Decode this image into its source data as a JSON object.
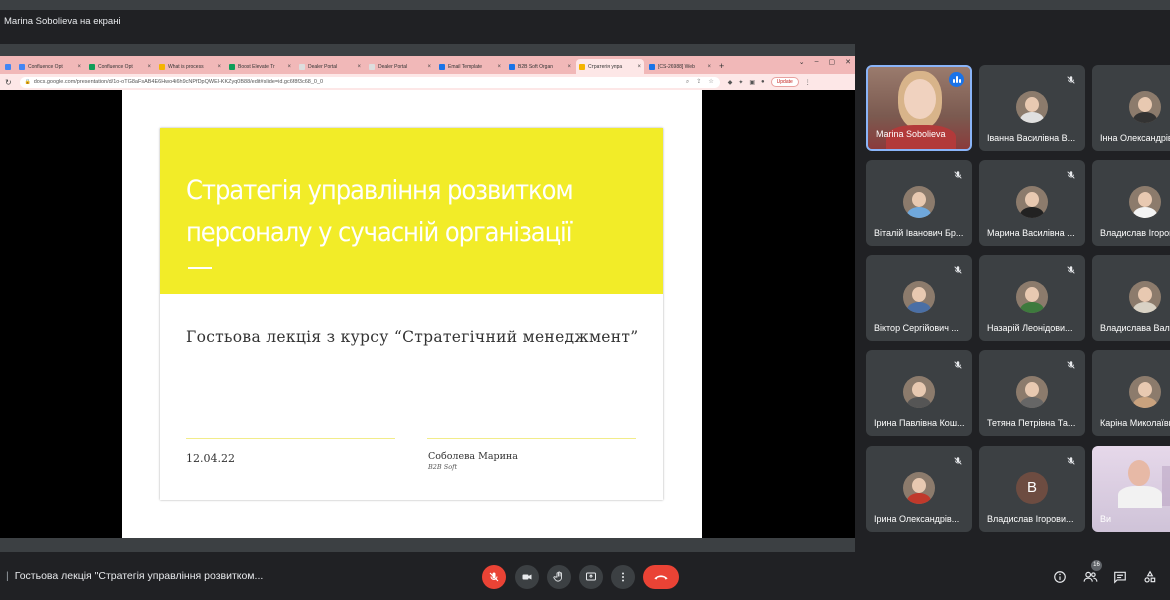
{
  "presenter_bar": {
    "text": "Marina Sobolieva на екрані"
  },
  "browser": {
    "tabs": [
      {
        "label": "",
        "color": "#4285f4"
      },
      {
        "label": "Confluence Opt",
        "color": "#4285f4"
      },
      {
        "label": "Confluence Opt",
        "color": "#0f9d58"
      },
      {
        "label": "What is process",
        "color": "#f4b400"
      },
      {
        "label": "Boost Elevate Tr",
        "color": "#0f9d58"
      },
      {
        "label": "Dealer Portal",
        "color": "#dddddd"
      },
      {
        "label": "Dealer Portal",
        "color": "#dddddd"
      },
      {
        "label": "Email Template",
        "color": "#1a73e8"
      },
      {
        "label": "B2B Soft Organ",
        "color": "#1a73e8"
      },
      {
        "label": "Стратегія упра",
        "color": "#f4b400",
        "active": true
      },
      {
        "label": "[CS-26988] Web",
        "color": "#1a73e8"
      }
    ],
    "new_tab": "+",
    "url": "docs.google.com/presentation/d/1o-oTG8aFsAB4E6Hwo4i6h9cNPfDpQWEl-KKZyq0B88/edit#slide=id.gc6f8f3c68_0_0",
    "update_label": "Update"
  },
  "slide": {
    "title": "Стратегія управління розвитком персоналу у сучасній організації",
    "subtitle": "Гостьова лекція з курсу “Стратегічний менеджмент”",
    "date": "12.04.22",
    "author": "Соболева Марина",
    "company": "B2B Soft"
  },
  "participants": [
    {
      "name": "Marina Sobolieva",
      "speaking": true
    },
    {
      "name": "Іванна Василівна В...",
      "shirt": "#e0e0e0"
    },
    {
      "name": "Інна Олександрівна",
      "shirt": "#333333"
    },
    {
      "name": "Віталій Іванович Бр...",
      "shirt": "#6fa8dc"
    },
    {
      "name": "Марина Василівна ...",
      "shirt": "#222222"
    },
    {
      "name": "Владислав Ігорович",
      "shirt": "#f3f3f3"
    },
    {
      "name": "Віктор Сергійович ...",
      "shirt": "#4a6fa5"
    },
    {
      "name": "Назарій Леонідови...",
      "shirt": "#3d7a3d"
    },
    {
      "name": "Владислава Вален",
      "shirt": "#d9d2c5"
    },
    {
      "name": "Ірина Павлівна Кош...",
      "shirt": "#555555"
    },
    {
      "name": "Тетяна Петрівна Та...",
      "shirt": "#666666"
    },
    {
      "name": "Каріна Миколаївна",
      "shirt": "#c9a27e"
    },
    {
      "name": "Ірина Олександрів...",
      "shirt": "#c0392b"
    },
    {
      "name": "Владислав Ігорови...",
      "initial": "B"
    },
    {
      "name": "Ви",
      "self": true
    }
  ],
  "bottom_bar": {
    "meeting_title": "Гостьова лекція \"Стратегія управління розвитком...",
    "participant_count": "16"
  },
  "colors": {
    "accent_yellow": "#f2ec28",
    "danger": "#ea4335",
    "speaking": "#8ab4f8"
  }
}
